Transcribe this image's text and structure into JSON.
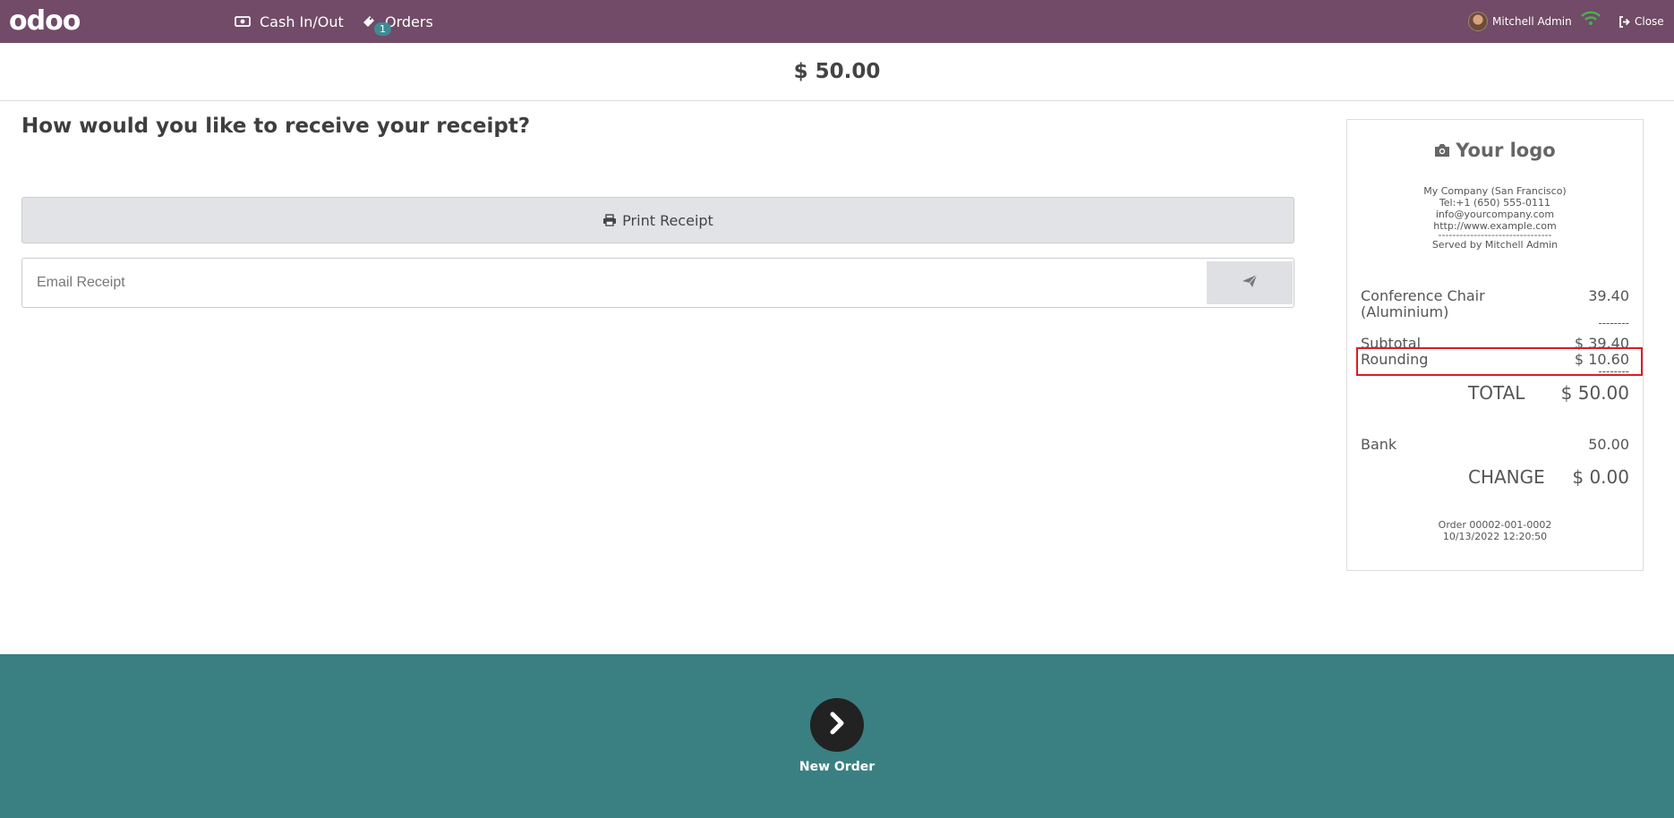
{
  "topbar": {
    "logo": "odoo",
    "cash_label": "Cash In/Out",
    "orders_label": "Orders",
    "orders_badge": "1",
    "user_name": "Mitchell Admin",
    "close_label": "Close"
  },
  "payment": {
    "amount": "$ 50.00",
    "question": "How would you like to receive your receipt?",
    "print_label": "Print Receipt",
    "email_placeholder": "Email Receipt"
  },
  "receipt": {
    "logo_text": "Your logo",
    "company": "My Company (San Francisco)",
    "tel": "Tel:+1 (650) 555-0111",
    "email": "info@yourcompany.com",
    "website": "http://www.example.com",
    "separator": "--------------------------------",
    "served_by": "Served by Mitchell Admin",
    "item_name": "Conference Chair (Aluminium)",
    "item_price": "39.40",
    "dash": "--------",
    "subtotal_label": "Subtotal",
    "subtotal_value": "$ 39.40",
    "rounding_label": "Rounding",
    "rounding_value": "$ 10.60",
    "total_label": "TOTAL",
    "total_value": "$ 50.00",
    "bank_label": "Bank",
    "bank_value": "50.00",
    "change_label": "CHANGE",
    "change_value": "$ 0.00",
    "order_ref": "Order 00002-001-0002",
    "order_date": "10/13/2022 12:20:50"
  },
  "footer": {
    "new_order_label": "New Order"
  },
  "colors": {
    "topbar": "#714b67",
    "bottom": "#3a8083",
    "highlight": "#e01b24"
  }
}
